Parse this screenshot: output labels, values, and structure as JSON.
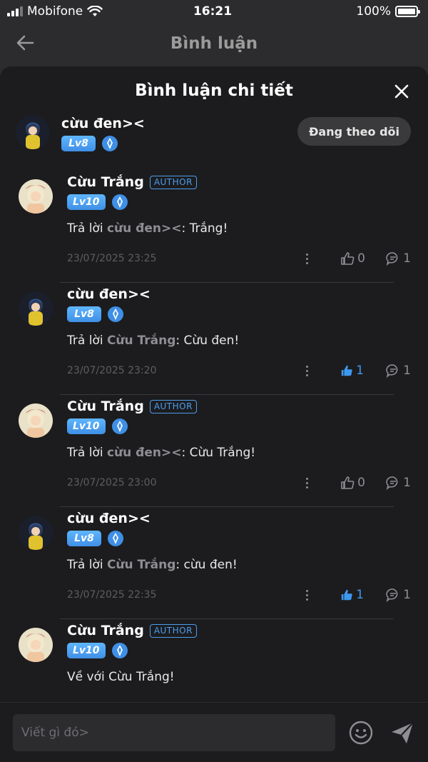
{
  "status_bar": {
    "carrier": "Mobifone",
    "time": "16:21",
    "battery": "100%"
  },
  "nav": {
    "title": "Bình luận"
  },
  "sheet": {
    "title": "Bình luận chi tiết"
  },
  "main_comment": {
    "username": "cừu đen><",
    "level": "Lv8",
    "follow_label": "Đang theo dõi"
  },
  "replies": [
    {
      "username": "Cừu Trắng",
      "author_tag": "AUTHOR",
      "level": "Lv10",
      "reply_prefix": "Trả lời ",
      "mention": "cừu đen><",
      "text": ": Trắng!",
      "timestamp": "23/07/2025 23:25",
      "likes": "0",
      "liked": false,
      "comments": "1"
    },
    {
      "username": "cừu đen><",
      "author_tag": "",
      "level": "Lv8",
      "reply_prefix": "Trả lời ",
      "mention": "Cừu Trắng",
      "text": ": Cừu đen!",
      "timestamp": "23/07/2025 23:20",
      "likes": "1",
      "liked": true,
      "comments": "1"
    },
    {
      "username": "Cừu Trắng",
      "author_tag": "AUTHOR",
      "level": "Lv10",
      "reply_prefix": "Trả lời ",
      "mention": "cừu đen><",
      "text": ": Cừu Trắng!",
      "timestamp": "23/07/2025 23:00",
      "likes": "0",
      "liked": false,
      "comments": "1"
    },
    {
      "username": "cừu đen><",
      "author_tag": "",
      "level": "Lv8",
      "reply_prefix": "Trả lời ",
      "mention": "Cừu Trắng",
      "text": ": cừu đen!",
      "timestamp": "23/07/2025 22:35",
      "likes": "1",
      "liked": true,
      "comments": "1"
    },
    {
      "username": "Cừu Trắng",
      "author_tag": "AUTHOR",
      "level": "Lv10",
      "reply_prefix": "",
      "mention": "",
      "text": "Về với Cừu Trắng!",
      "timestamp": "",
      "likes": "",
      "liked": false,
      "comments": ""
    }
  ],
  "input": {
    "placeholder": "Viết gì đó>"
  },
  "colors": {
    "accent": "#3d98f0",
    "background": "#1c1c1e",
    "muted": "#8e8e93"
  },
  "icons": {
    "back": "arrow-left-icon",
    "close": "close-icon",
    "like": "thumbs-up-icon",
    "comment": "comment-bubble-icon",
    "emoji": "emoji-icon",
    "send": "send-icon",
    "gem": "gem-badge-icon"
  }
}
